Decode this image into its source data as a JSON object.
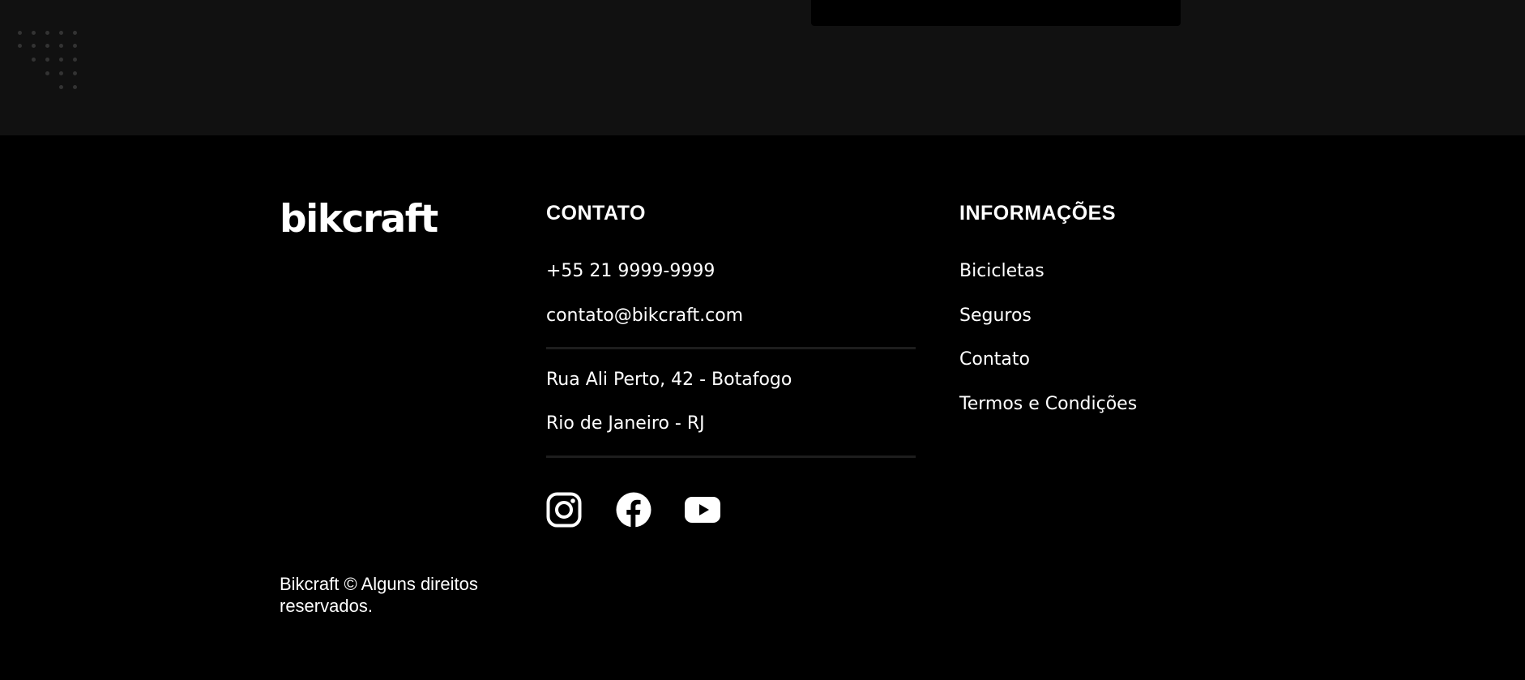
{
  "brand": {
    "logo": "bikcraft"
  },
  "contato": {
    "title": "CONTATO",
    "phone": "+55 21 9999-9999",
    "email": "contato@bikcraft.com",
    "address_line1": "Rua Ali Perto, 42 - Botafogo",
    "address_line2": "Rio de Janeiro - RJ",
    "social": [
      {
        "name": "instagram-icon"
      },
      {
        "name": "facebook-icon"
      },
      {
        "name": "youtube-icon"
      }
    ]
  },
  "informacoes": {
    "title": "INFORMAÇÕES",
    "links": [
      {
        "label": "Bicicletas"
      },
      {
        "label": "Seguros"
      },
      {
        "label": "Contato"
      },
      {
        "label": "Termos e Condições"
      }
    ]
  },
  "copyright": "Bikcraft © Alguns direitos reservados.",
  "colors": {
    "top_band": "#111111",
    "footer_bg": "#000000",
    "text": "#ffffff",
    "divider": "#1d1d1d",
    "dots": "#333333"
  }
}
